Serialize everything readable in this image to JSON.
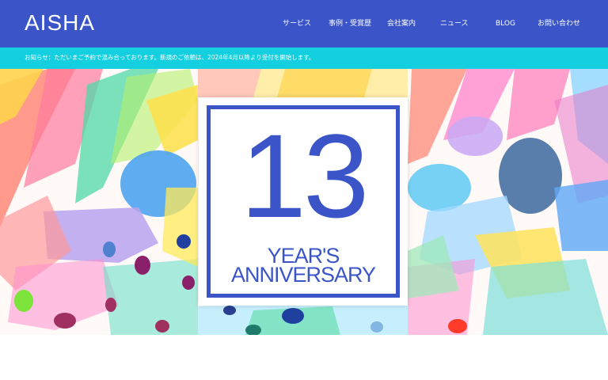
{
  "header": {
    "logo": "AISHA",
    "nav": [
      {
        "label": "サービス"
      },
      {
        "label": "事例・受賞歴"
      },
      {
        "label": "会社案内"
      },
      {
        "label": "ニュース"
      },
      {
        "label": "BLOG"
      },
      {
        "label": "お問い合わせ"
      }
    ]
  },
  "notice": {
    "text": "お知らせ：ただいまご予約で混み合っております。新規のご依頼は、2024年4月以降より受付を開始します。"
  },
  "hero": {
    "number": "13",
    "line1": "YEAR'S",
    "line2": "ANNIVERSARY"
  },
  "colors": {
    "brand_blue": "#3b55c9",
    "notice_cyan": "#14cfe0"
  }
}
